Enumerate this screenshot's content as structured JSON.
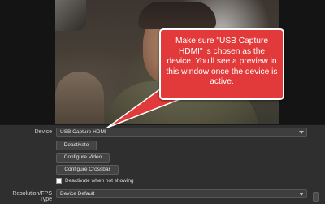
{
  "callout": {
    "text": "Make sure \"USB Capture HDMI\" is chosen as the device. You'll see a preview in this window once the device is active.",
    "color": "#e23a3a"
  },
  "properties": {
    "device_label": "Device",
    "device_value": "USB Capture HDMI",
    "deactivate_label": "Deactivate",
    "configure_video_label": "Configure Video",
    "configure_crossbar_label": "Configure Crossbar",
    "deactivate_when_not_showing_label": "Deactivate when not showing",
    "deactivate_when_not_showing_checked": false,
    "resolution_label": "Resolution/FPS Type",
    "resolution_value": "Device Default"
  }
}
